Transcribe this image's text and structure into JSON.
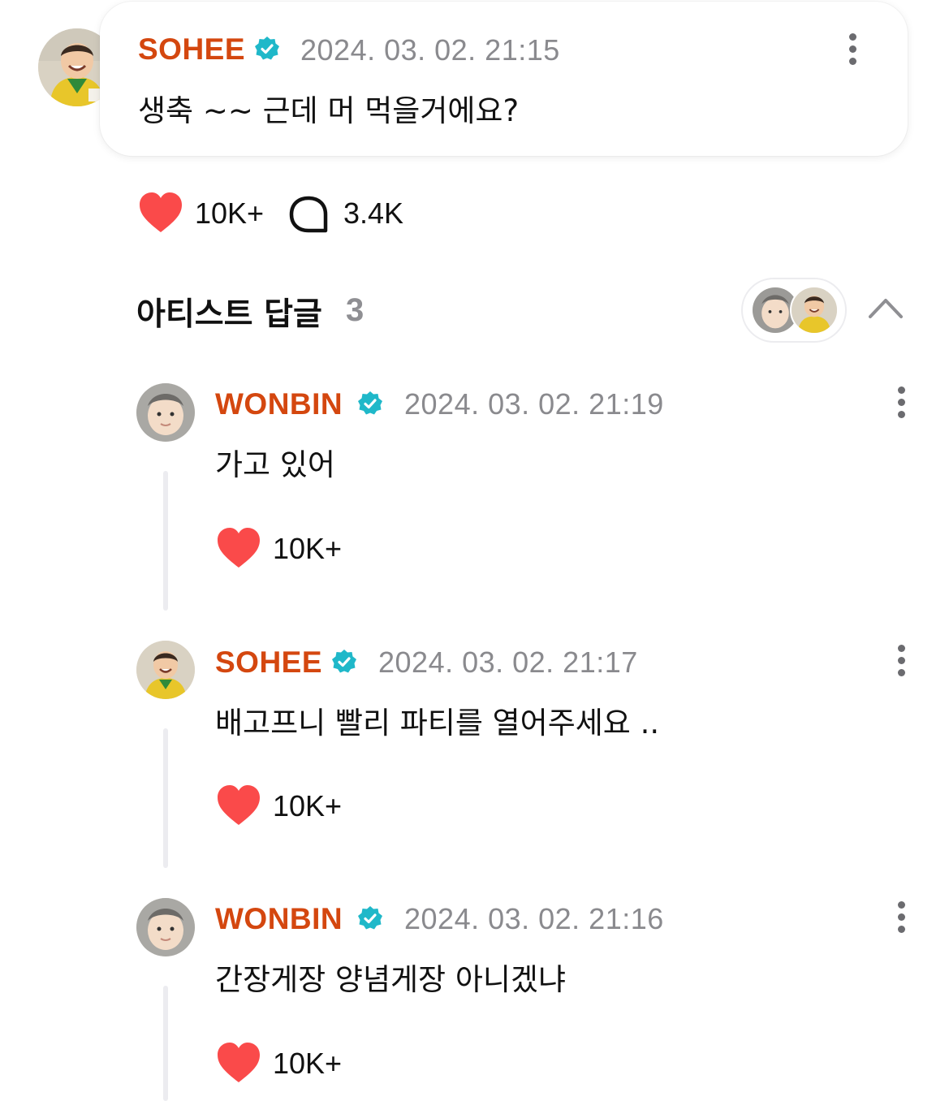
{
  "main_comment": {
    "author": "SOHEE",
    "timestamp": "2024. 03. 02. 21:15",
    "text": "생축 ~~ 근데 머 먹을거에요?",
    "likes": "10K+",
    "replies": "3.4K"
  },
  "artist_replies": {
    "title": "아티스트 답글",
    "count": "3",
    "items": [
      {
        "author": "WONBIN",
        "timestamp": "2024. 03. 02. 21:19",
        "text": "가고 있어",
        "likes": "10K+"
      },
      {
        "author": "SOHEE",
        "timestamp": "2024. 03. 02. 21:17",
        "text": "배고프니 빨리 파티를 열어주세요 ..",
        "likes": "10K+"
      },
      {
        "author": "WONBIN",
        "timestamp": "2024. 03. 02. 21:16",
        "text": "간장게장 양념게장 아니겠냐",
        "likes": "10K+"
      }
    ]
  },
  "colors": {
    "name": "#d4470f",
    "verified_badge": "#1fb8c9",
    "heart": "#fa4a4a",
    "timestamp": "#8a8a8e"
  },
  "icons": [
    "verified-badge-icon",
    "more-options-icon",
    "heart-icon",
    "comment-bubble-icon",
    "chevron-up-icon"
  ]
}
